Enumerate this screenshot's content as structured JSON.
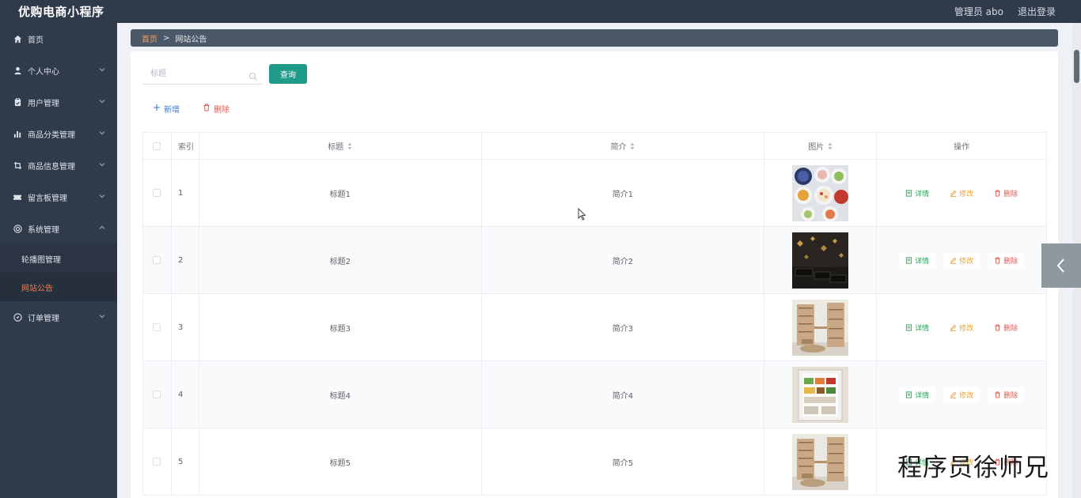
{
  "app": {
    "title": "优购电商小程序"
  },
  "header": {
    "user_label": "管理员 abo",
    "logout_label": "退出登录"
  },
  "sidebar": {
    "items": [
      {
        "label": "首页",
        "icon": "home-icon"
      },
      {
        "label": "个人中心",
        "icon": "user-icon"
      },
      {
        "label": "用户管理",
        "icon": "clipboard-icon"
      },
      {
        "label": "商品分类管理",
        "icon": "bar-chart-icon"
      },
      {
        "label": "商品信息管理",
        "icon": "crop-icon"
      },
      {
        "label": "留言板管理",
        "icon": "ticket-icon"
      },
      {
        "label": "系统管理",
        "icon": "settings-circle-icon"
      },
      {
        "label": "订单管理",
        "icon": "compass-icon"
      }
    ],
    "system_sub": [
      {
        "label": "轮播图管理"
      },
      {
        "label": "网站公告"
      }
    ]
  },
  "breadcrumb": {
    "home": "首页",
    "separator": ">",
    "current": "网站公告"
  },
  "search": {
    "placeholder": "标题",
    "value": "",
    "button_label": "查询"
  },
  "toolbar": {
    "add_label": "新增",
    "delete_label": "删除"
  },
  "table": {
    "headers": {
      "index": "索引",
      "title": "标题",
      "intro": "简介",
      "image": "图片",
      "ops": "操作"
    },
    "ops": {
      "detail": "详情",
      "edit": "修改",
      "delete": "删除"
    },
    "rows": [
      {
        "index": "1",
        "title": "标题1",
        "intro": "简介1",
        "image": "food-bowls-photo"
      },
      {
        "index": "2",
        "title": "标题2",
        "intro": "简介2",
        "image": "dark-cabinet-photo"
      },
      {
        "index": "3",
        "title": "标题3",
        "intro": "简介3",
        "image": "bookshelf-room-photo"
      },
      {
        "index": "4",
        "title": "标题4",
        "intro": "简介4",
        "image": "open-fridge-photo"
      },
      {
        "index": "5",
        "title": "标题5",
        "intro": "简介5",
        "image": "bookshelf-room-photo"
      }
    ]
  },
  "watermark": "程序员徐师兄",
  "colors": {
    "sidebar_bg": "#2f3a4a",
    "accent": "#1f9b8a",
    "active_menu": "#f57c4c",
    "danger": "#e05a4f",
    "warning": "#e6a23c",
    "success": "#27a35a",
    "link": "#3a7bd5"
  }
}
